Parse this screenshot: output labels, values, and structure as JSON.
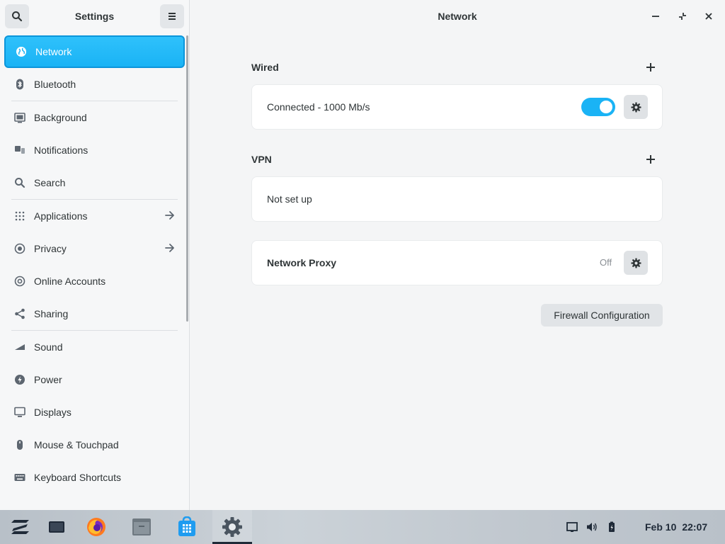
{
  "sidebar": {
    "title": "Settings",
    "items": [
      {
        "label": "Network",
        "icon": "globe-icon"
      },
      {
        "label": "Bluetooth",
        "icon": "bluetooth-icon"
      },
      {
        "label": "Background",
        "icon": "background-icon"
      },
      {
        "label": "Notifications",
        "icon": "notifications-icon"
      },
      {
        "label": "Search",
        "icon": "search-icon"
      },
      {
        "label": "Applications",
        "icon": "grid-icon"
      },
      {
        "label": "Privacy",
        "icon": "privacy-icon"
      },
      {
        "label": "Online Accounts",
        "icon": "at-icon"
      },
      {
        "label": "Sharing",
        "icon": "share-icon"
      },
      {
        "label": "Sound",
        "icon": "sound-icon"
      },
      {
        "label": "Power",
        "icon": "power-icon"
      },
      {
        "label": "Displays",
        "icon": "display-icon"
      },
      {
        "label": "Mouse & Touchpad",
        "icon": "mouse-icon"
      },
      {
        "label": "Keyboard Shortcuts",
        "icon": "keyboard-icon"
      }
    ]
  },
  "main": {
    "title": "Network",
    "wired": {
      "label": "Wired",
      "status": "Connected - 1000 Mb/s",
      "enabled": true
    },
    "vpn": {
      "label": "VPN",
      "status": "Not set up"
    },
    "proxy": {
      "label": "Network Proxy",
      "state": "Off"
    },
    "firewall_button": "Firewall Configuration"
  },
  "taskbar": {
    "apps": [
      "zorin-menu-icon",
      "desktop-icon",
      "firefox-icon",
      "files-icon",
      "software-icon",
      "settings-icon"
    ],
    "date": "Feb 10",
    "time": "22:07"
  },
  "colors": {
    "accent": "#1ab3f5",
    "accent_border": "#0c95da"
  }
}
